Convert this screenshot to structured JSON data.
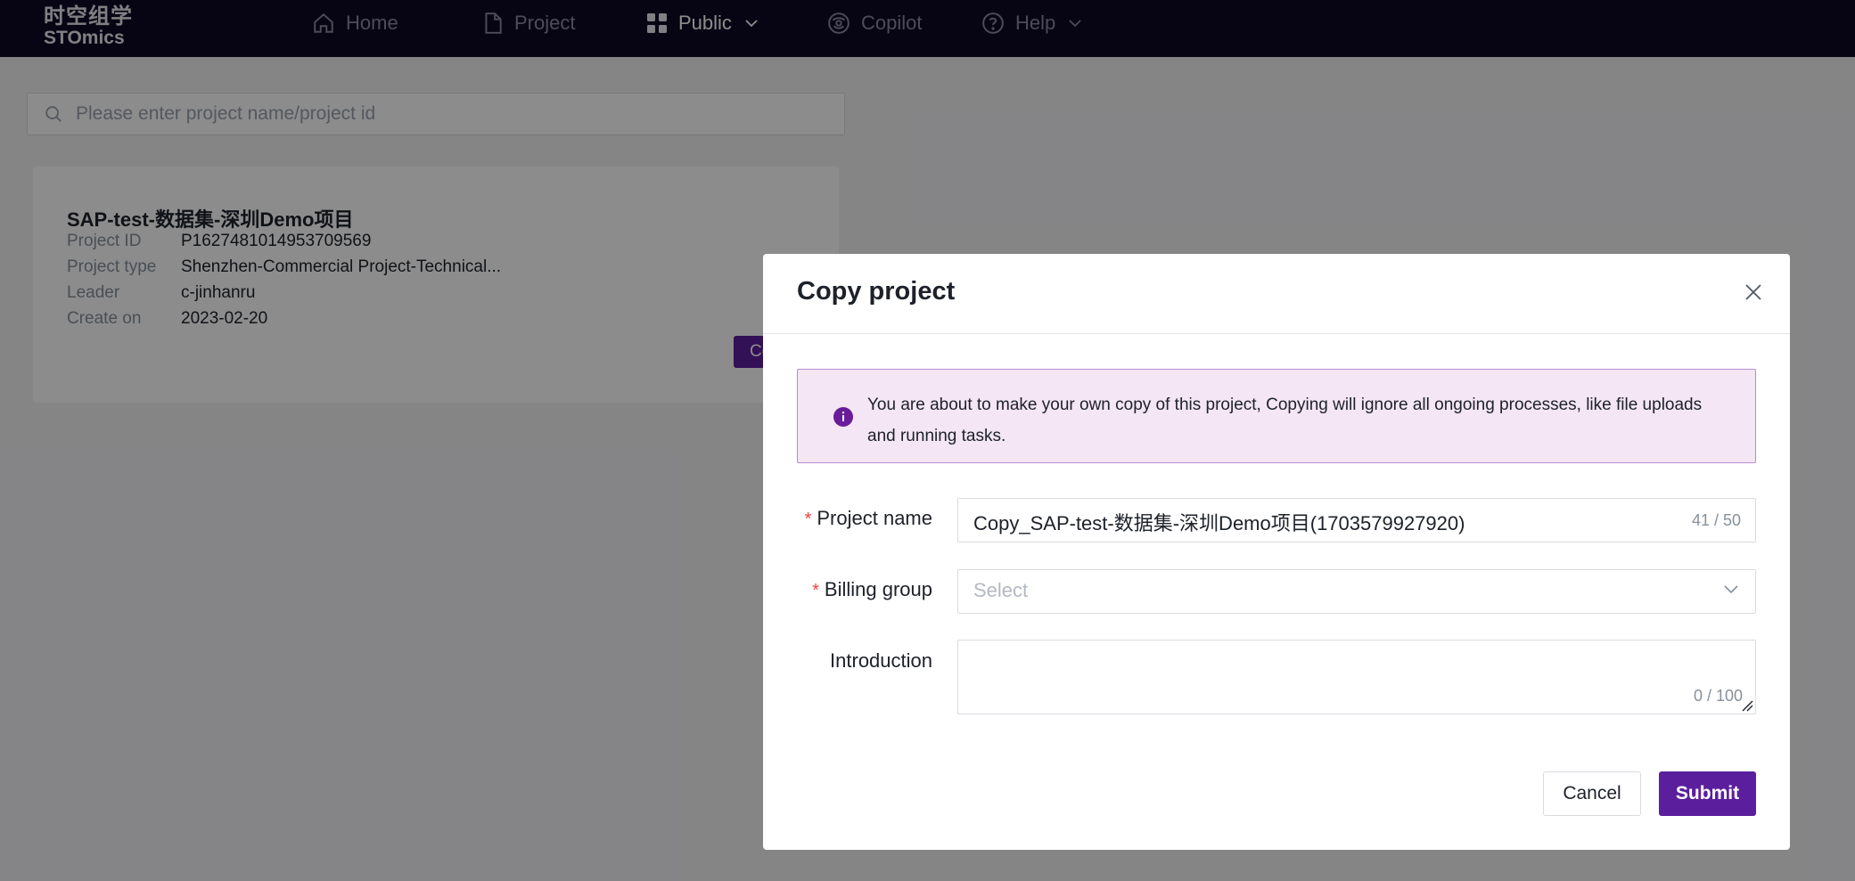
{
  "brand": {
    "line1": "时空组学",
    "line2": "STOmics"
  },
  "nav": {
    "home": "Home",
    "project": "Project",
    "public": "Public",
    "copilot": "Copilot",
    "help": "Help"
  },
  "search": {
    "placeholder": "Please enter project name/project id"
  },
  "project_card": {
    "title": "SAP-test-数据集-深圳Demo项目",
    "fields": [
      {
        "label": "Project ID",
        "value": "P1627481014953709569"
      },
      {
        "label": "Project type",
        "value": "Shenzhen-Commercial Project-Technical..."
      },
      {
        "label": "Leader",
        "value": "c-jinhanru"
      },
      {
        "label": "Create on",
        "value": "2023-02-20"
      }
    ],
    "button_label": "Co"
  },
  "modal": {
    "title": "Copy project",
    "alert_text": "You are about to make your own copy of this project, Copying will ignore all ongoing processes, like file uploads and running tasks.",
    "project_name": {
      "label": "Project name",
      "required_mark": "*",
      "value": "Copy_SAP-test-数据集-深圳Demo项目(1703579927920)",
      "counter": "41 / 50"
    },
    "billing_group": {
      "label": "Billing group",
      "required_mark": "*",
      "placeholder": "Select"
    },
    "introduction": {
      "label": "Introduction",
      "value": "",
      "counter": "0 / 100"
    },
    "cancel_label": "Cancel",
    "submit_label": "Submit"
  },
  "colors": {
    "nav_bg": "#0d0a26",
    "accent": "#5b1f9e",
    "alert_bg": "#f4e6f4",
    "alert_border": "#b88bd1",
    "required": "#f53f3f"
  }
}
